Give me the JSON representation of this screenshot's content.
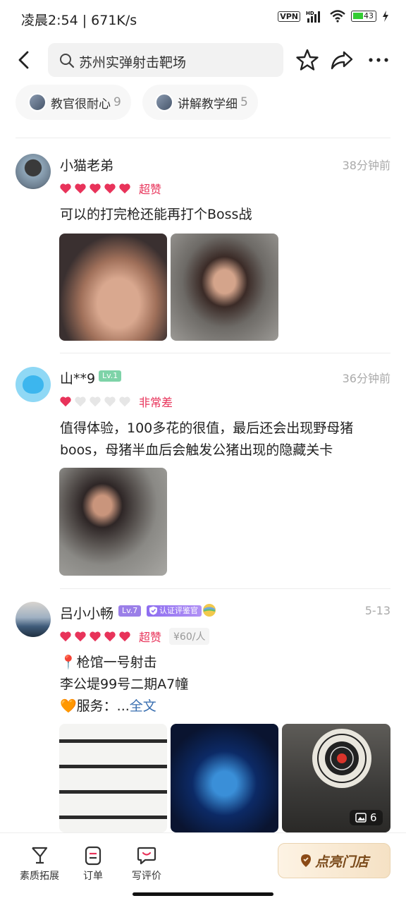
{
  "status_bar": {
    "time": "凌晨2:54 | 671K/s",
    "vpn": "VPN",
    "hd": "HD",
    "battery": "43"
  },
  "header": {
    "search_text": "苏州实弹射击靶场"
  },
  "tags": [
    {
      "label": "教官很耐心",
      "count": "9"
    },
    {
      "label": "讲解教学细",
      "count": "5"
    }
  ],
  "reviews": [
    {
      "user": "小猫老弟",
      "time": "38分钟前",
      "hearts": 5,
      "rating_text": "超赞",
      "text": "可以的打完枪还能再打个Boss战"
    },
    {
      "user": "山**9",
      "level": "Lv.1",
      "time": "36分钟前",
      "hearts": 1,
      "rating_text": "非常差",
      "text_lines": [
        "值得体验，100多花的很值，最后还会出现野母猪",
        "boos，母猪半血后会触发公猪出现的隐藏关卡"
      ]
    },
    {
      "user": "吕小小畅",
      "level": "Lv.7",
      "cert": "认证评鉴官",
      "time": "5-13",
      "hearts": 5,
      "rating_text": "超赞",
      "price": "¥60/人",
      "line1": "📍枪馆一号射击",
      "line2": "李公堤99号二期A7幢",
      "line3_prefix": "🧡服务：...",
      "more": "全文",
      "photo_count": "6"
    }
  ],
  "bottom_bar": {
    "items": [
      "素质拓展",
      "订单",
      "写评价"
    ],
    "cta": "点亮门店"
  },
  "colors": {
    "heart": "#e8335a",
    "accent": "#e8335a",
    "level1": "#7ed3a8",
    "level7": "#9b7fe8"
  }
}
